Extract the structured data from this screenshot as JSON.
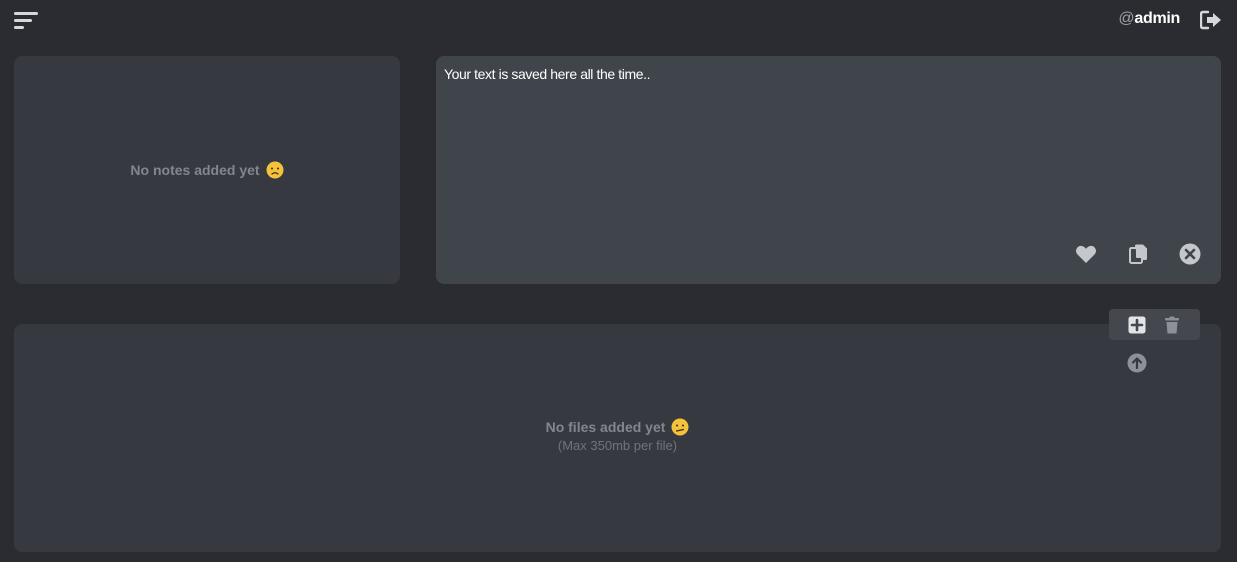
{
  "header": {
    "at_symbol": "@",
    "username": "admin",
    "menu_icon": "hamburger-menu-icon",
    "logout_icon": "sign-out-icon"
  },
  "notes": {
    "empty_message": "No notes added yet",
    "empty_emoji": "worried-face-emoji"
  },
  "editor": {
    "placeholder": "Your text is saved here all the time..",
    "actions": [
      "heart-icon",
      "copy-icon",
      "close-circle-icon"
    ]
  },
  "files": {
    "empty_message": "No files added yet",
    "empty_emoji": "confused-face-emoji",
    "limit_note": "(Max 350mb per file)",
    "toolbar": [
      "plus-square-icon",
      "trash-icon"
    ],
    "upload_icon": "upload-circle-icon"
  },
  "colors": {
    "background": "#2b2c31",
    "panel": "#373940",
    "editor": "#40444b",
    "muted_text": "#82868d",
    "icon": "#c4c7cc",
    "emoji": "#f5c33b"
  }
}
